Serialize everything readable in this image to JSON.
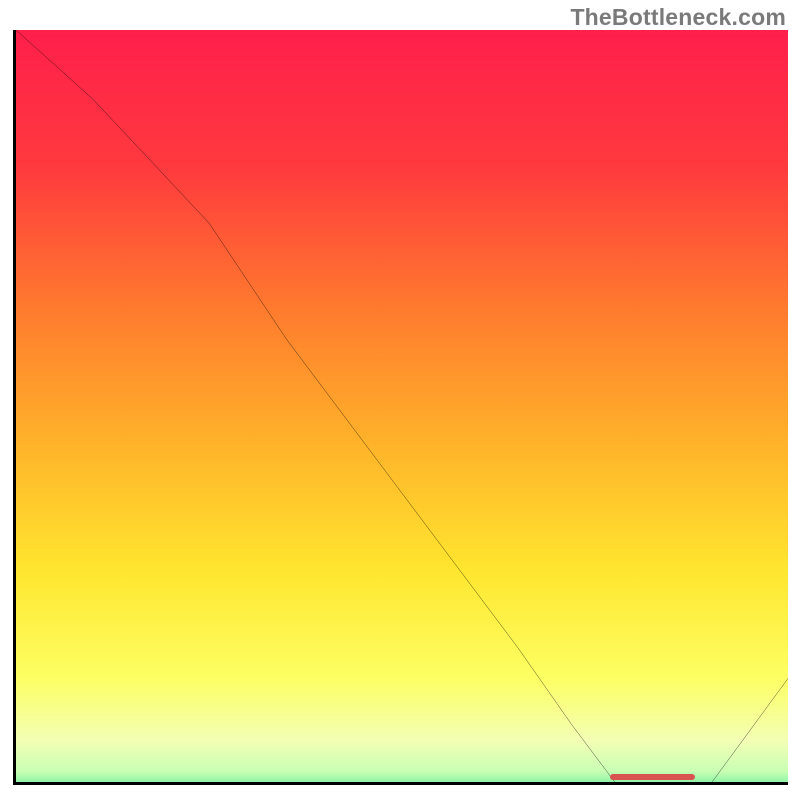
{
  "watermark": {
    "text": "TheBottleneck.com"
  },
  "chart_data": {
    "type": "line",
    "title": "",
    "xlabel": "",
    "ylabel": "",
    "xlim": [
      0,
      100
    ],
    "ylim": [
      0,
      100
    ],
    "series": [
      {
        "name": "curve",
        "x": [
          0,
          10,
          25,
          35,
          50,
          65,
          72,
          78,
          85,
          89,
          100
        ],
        "y": [
          100,
          91,
          75,
          60,
          40,
          20,
          10,
          2,
          0.5,
          1,
          16
        ]
      }
    ],
    "optimal_region": {
      "x_start": 77,
      "x_end": 88,
      "y": 0.5
    },
    "gradient_stops": [
      {
        "pct": 0,
        "color": "#ff1f4b"
      },
      {
        "pct": 18,
        "color": "#ff3a3e"
      },
      {
        "pct": 36,
        "color": "#ff7a2e"
      },
      {
        "pct": 54,
        "color": "#ffb42a"
      },
      {
        "pct": 70,
        "color": "#ffe62f"
      },
      {
        "pct": 84,
        "color": "#fdff63"
      },
      {
        "pct": 92,
        "color": "#f3ffb4"
      },
      {
        "pct": 96,
        "color": "#c9ffb4"
      },
      {
        "pct": 98,
        "color": "#7af0a2"
      },
      {
        "pct": 100,
        "color": "#2fe08c"
      }
    ]
  }
}
